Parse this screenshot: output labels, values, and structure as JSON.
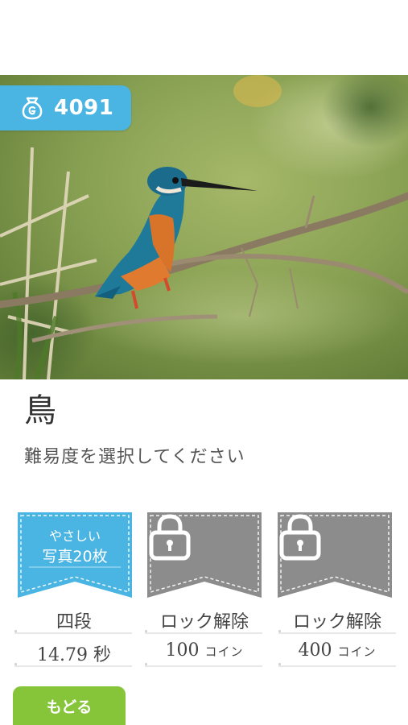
{
  "coins": {
    "count": "4091",
    "icon": "coin-bag-icon"
  },
  "category": {
    "title": "鳥",
    "subtitle": "難易度を選択してください"
  },
  "difficulties": [
    {
      "state": "unlocked",
      "line1": "やさしい",
      "line2": "写真20枚",
      "rank": "四段",
      "stat": "14.79",
      "stat_unit": "秒",
      "color": "#4ab4e2"
    },
    {
      "state": "locked",
      "icon": "lock-icon",
      "action": "ロック解除",
      "price": "100",
      "price_unit": "コイン",
      "color": "#8c8c8c"
    },
    {
      "state": "locked",
      "icon": "lock-icon",
      "action": "ロック解除",
      "price": "400",
      "price_unit": "コイン",
      "color": "#8c8c8c"
    }
  ],
  "back_button": {
    "label": "もどる",
    "color": "#86c43a"
  },
  "hero_image": {
    "subject": "kingfisher on branch"
  }
}
